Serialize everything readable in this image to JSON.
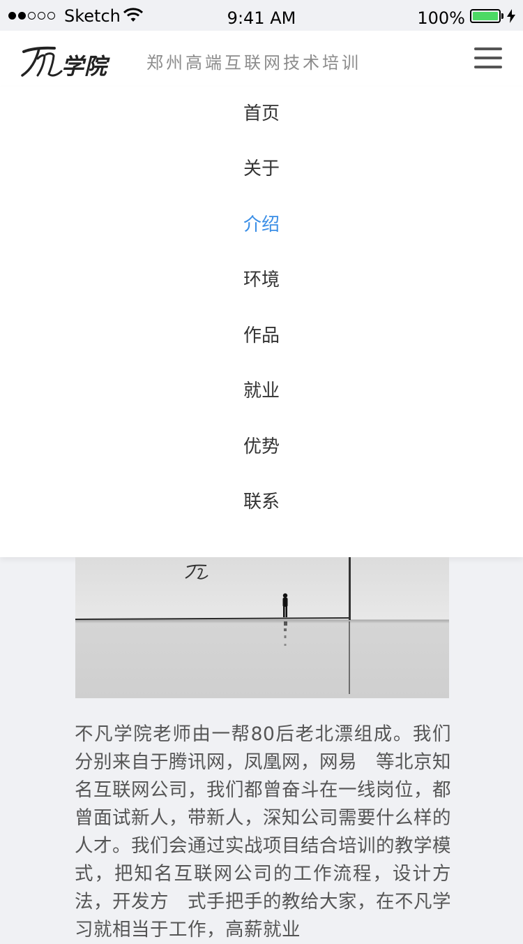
{
  "status_bar": {
    "carrier": "Sketch",
    "time": "9:41 AM",
    "battery_percent": "100%",
    "battery_level": 1.0,
    "signal_bars_filled": 2,
    "signal_bars_total": 5
  },
  "header": {
    "logo_text": "学院",
    "tagline": "郑州高端互联网技术培训",
    "menu_icon": "hamburger-icon"
  },
  "nav": {
    "items": [
      {
        "label": "首页",
        "active": false
      },
      {
        "label": "关于",
        "active": false
      },
      {
        "label": "介绍",
        "active": true
      },
      {
        "label": "环境",
        "active": false
      },
      {
        "label": "作品",
        "active": false
      },
      {
        "label": "就业",
        "active": false
      },
      {
        "label": "优势",
        "active": false
      },
      {
        "label": "联系",
        "active": false
      }
    ],
    "active_color": "#3a8ee6"
  },
  "content": {
    "paragraph": "不凡学院老师由一帮80后老北漂组成。我们分别来自于腾讯网，凤凰网，网易　等北京知名互联网公司，我们都曾奋斗在一线岗位，都曾面试新人，带新人，深知公司需要什么样的人才。我们会通过实战项目结合培训的教学模式，把知名互联网公司的工作流程，设计方法，开发方　式手把手的教给大家，在不凡学习就相当于工作，高薪就业"
  }
}
